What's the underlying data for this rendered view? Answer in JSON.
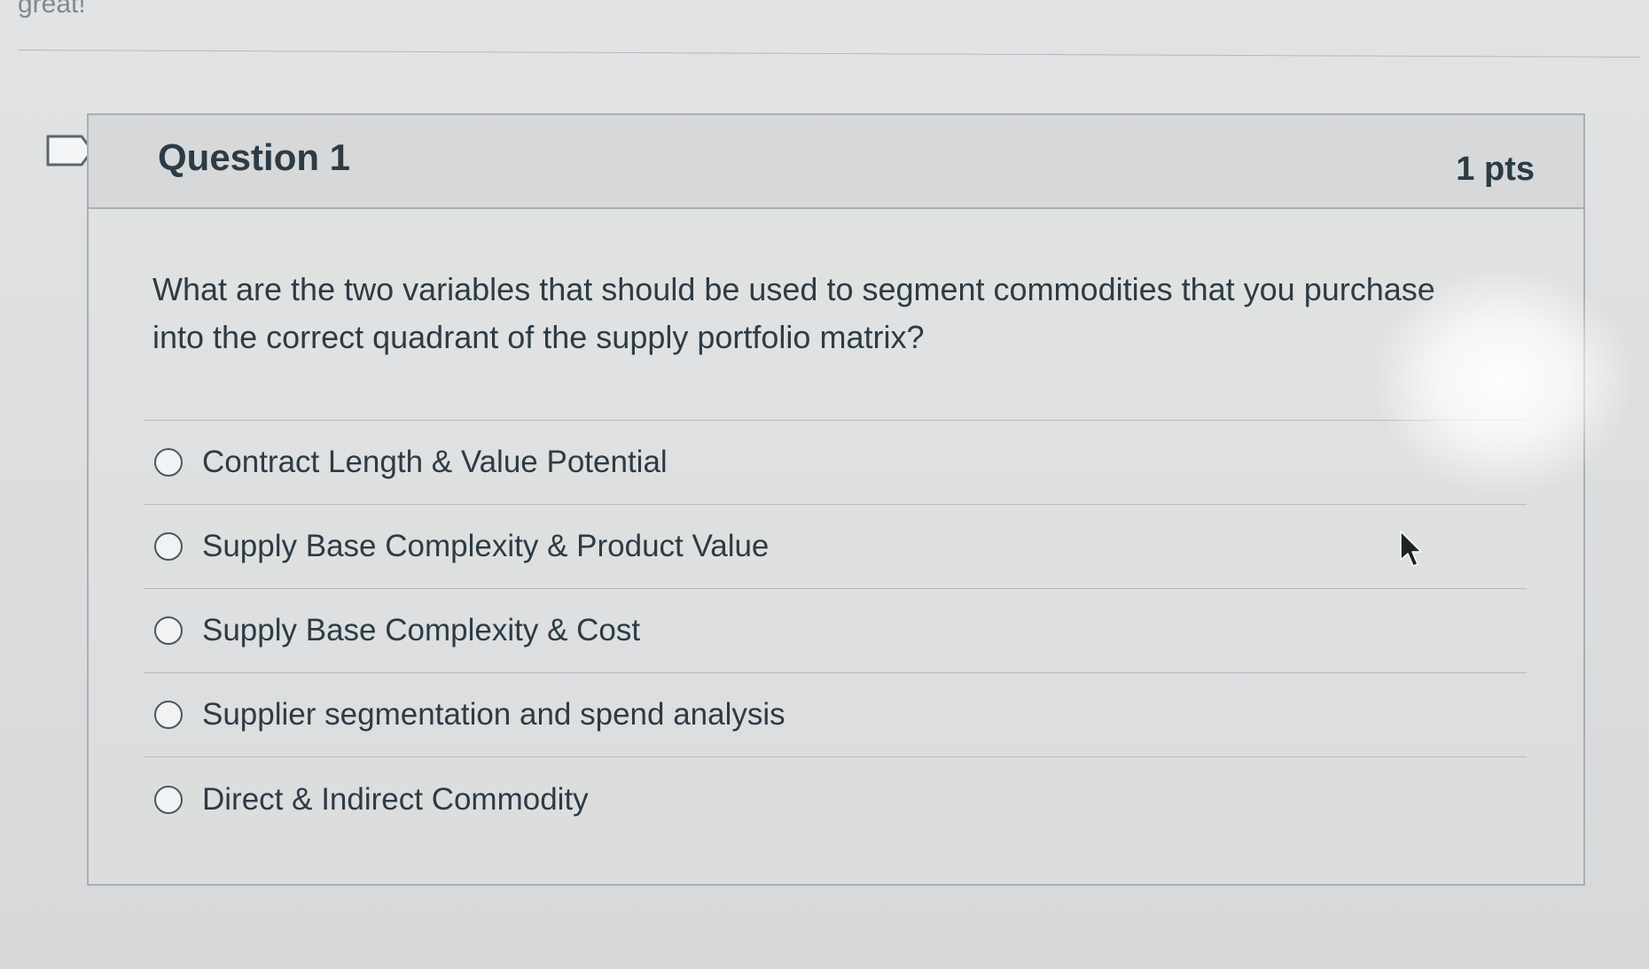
{
  "top": {
    "partial_text": "great!"
  },
  "question": {
    "title": "Question 1",
    "points": "1 pts",
    "text": "What are the two variables that should be used to segment commodities that you purchase into the correct quadrant of the supply portfolio matrix?",
    "answers": [
      {
        "label": "Contract Length & Value Potential",
        "selected": false
      },
      {
        "label": "Supply Base Complexity & Product Value",
        "selected": false
      },
      {
        "label": "Supply Base Complexity & Cost",
        "selected": false
      },
      {
        "label": "Supplier segmentation and spend analysis",
        "selected": false
      },
      {
        "label": "Direct & Indirect Commodity",
        "selected": false
      }
    ]
  },
  "icons": {
    "flag": "flag-question-icon",
    "cursor": "mouse-pointer-icon"
  },
  "colors": {
    "text": "#2d3b45",
    "border": "#a9aeb3",
    "header_bg": "#d6d8da",
    "page_bg": "#dddedf"
  }
}
